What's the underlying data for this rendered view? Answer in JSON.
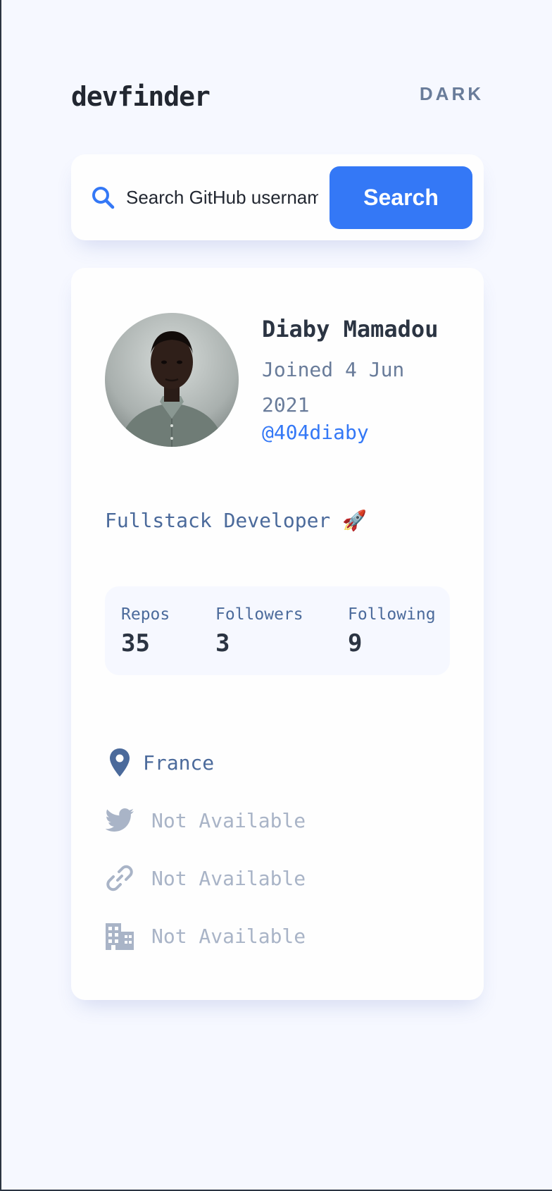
{
  "app": {
    "logo": "devfinder",
    "theme_toggle_label": "DARK"
  },
  "search": {
    "placeholder": "Search GitHub username…",
    "button_label": "Search",
    "icon": "search-icon"
  },
  "profile": {
    "name": "Diaby Mamadou",
    "joined_line1": "Joined 4 Jun",
    "joined_line2": "2021",
    "login": "@404diaby",
    "bio": "Fullstack Developer 🚀",
    "stats": {
      "repos_label": "Repos",
      "repos_value": "35",
      "followers_label": "Followers",
      "followers_value": "3",
      "following_label": "Following",
      "following_value": "9"
    },
    "links": {
      "location": "France",
      "twitter": "Not Available",
      "blog": "Not Available",
      "company": "Not Available"
    }
  },
  "colors": {
    "accent": "#3478f6",
    "background": "#f6f8ff",
    "card": "#fefefe",
    "heading": "#2b3442",
    "muted": "#697c9a",
    "body_text": "#4b6a9b",
    "unavailable": "#a9b4c7"
  }
}
